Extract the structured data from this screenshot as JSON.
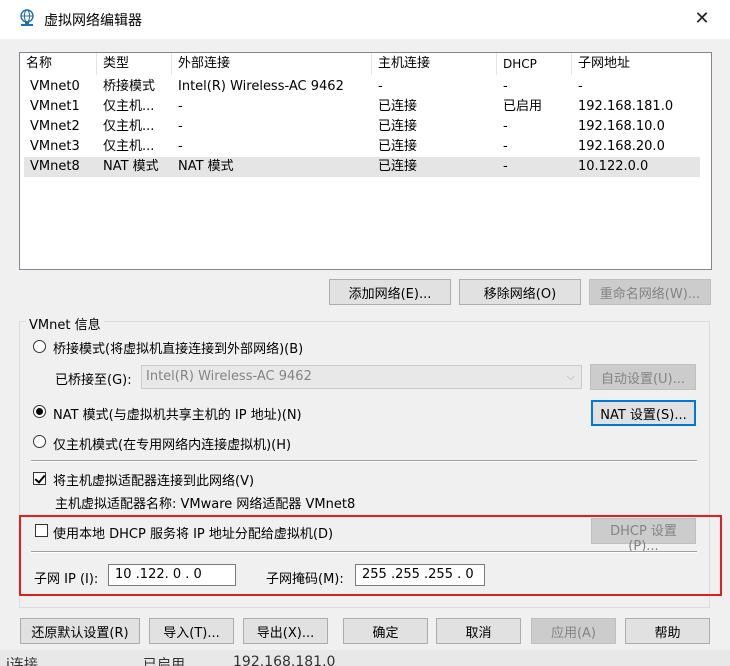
{
  "window": {
    "title": "虚拟网络编辑器",
    "close_glyph": "✕"
  },
  "table": {
    "columns": [
      "名称",
      "类型",
      "外部连接",
      "主机连接",
      "DHCP",
      "子网地址"
    ],
    "rows": [
      [
        "VMnet0",
        "桥接模式",
        "Intel(R) Wireless-AC 9462",
        "-",
        "-",
        "-"
      ],
      [
        "VMnet1",
        "仅主机...",
        "-",
        "已连接",
        "已启用",
        "192.168.181.0"
      ],
      [
        "VMnet2",
        "仅主机...",
        "-",
        "已连接",
        "-",
        "192.168.10.0"
      ],
      [
        "VMnet3",
        "仅主机...",
        "-",
        "已连接",
        "-",
        "192.168.20.0"
      ],
      [
        "VMnet8",
        "NAT 模式",
        "NAT 模式",
        "已连接",
        "-",
        "10.122.0.0"
      ]
    ],
    "selected_row": 4
  },
  "table_buttons": {
    "add": "添加网络(E)...",
    "remove": "移除网络(O)",
    "rename": "重命名网络(W)..."
  },
  "vmnet_info": {
    "group_title": "VMnet 信息",
    "bridged_label": "桥接模式(将虚拟机直接连接到外部网络)(B)",
    "bridged_to_label": "已桥接至(G):",
    "bridged_to_value": "Intel(R) Wireless-AC 9462",
    "auto_settings": "自动设置(U)...",
    "nat_label": "NAT 模式(与虚拟机共享主机的 IP 地址)(N)",
    "nat_settings": "NAT 设置(S)...",
    "hostonly_label": "仅主机模式(在专用网络内连接虚拟机)(H)",
    "connect_adapter_label": "将主机虚拟适配器连接到此网络(V)",
    "adapter_name_label": "主机虚拟适配器名称: VMware 网络适配器 VMnet8",
    "dhcp_label": "使用本地 DHCP 服务将 IP 地址分配给虚拟机(D)",
    "dhcp_settings": "DHCP 设置(P)...",
    "subnet_ip_label": "子网 IP (I):",
    "subnet_ip_value": "10 .122. 0 . 0",
    "subnet_mask_label": "子网掩码(M):",
    "subnet_mask_value": "255 .255 .255 . 0",
    "mode_selected": "nat",
    "connect_adapter_checked": true,
    "dhcp_checked": false
  },
  "footer_buttons": {
    "restore": "还原默认设置(R)",
    "import": "导入(T)...",
    "export": "导出(X)...",
    "ok": "确定",
    "cancel": "取消",
    "apply": "应用(A)",
    "help": "帮助"
  },
  "behind": {
    "text1": "i连接",
    "text2": "已启用",
    "text3": "192.168.181.0"
  },
  "colors": {
    "highlight_box": "#e02020",
    "focus_border": "#0078d7",
    "selected_row": "#e5e5e5"
  }
}
